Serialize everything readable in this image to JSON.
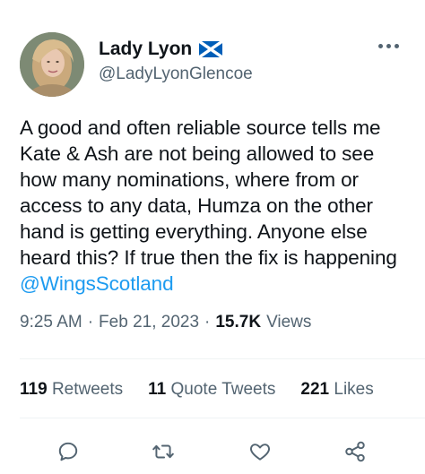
{
  "author": {
    "display_name": "Lady Lyon",
    "handle": "@LadyLyonGlencoe",
    "badge_icon": "scotland-flag-icon"
  },
  "tweet": {
    "text_before_mention": "A good and often reliable source tells me Kate & Ash are not being allowed to see how many nominations, where from or access to any data, Humza on the other hand is getting everything. Anyone else heard this? If true then the fix is happening ",
    "mention": "@WingsScotland"
  },
  "meta": {
    "time": "9:25 AM",
    "separator": "·",
    "date": "Feb 21, 2023",
    "views_count": "15.7K",
    "views_label": "Views"
  },
  "stats": {
    "retweets_count": "119",
    "retweets_label": "Retweets",
    "quotes_count": "11",
    "quotes_label": "Quote Tweets",
    "likes_count": "221",
    "likes_label": "Likes"
  },
  "actions": {
    "reply_icon": "reply-icon",
    "retweet_icon": "retweet-icon",
    "like_icon": "heart-icon",
    "share_icon": "share-icon"
  },
  "colors": {
    "text": "#0f1419",
    "secondary": "#536471",
    "accent": "#1d9bf0",
    "divider": "#eff3f4",
    "flag_blue": "#005eb8"
  }
}
